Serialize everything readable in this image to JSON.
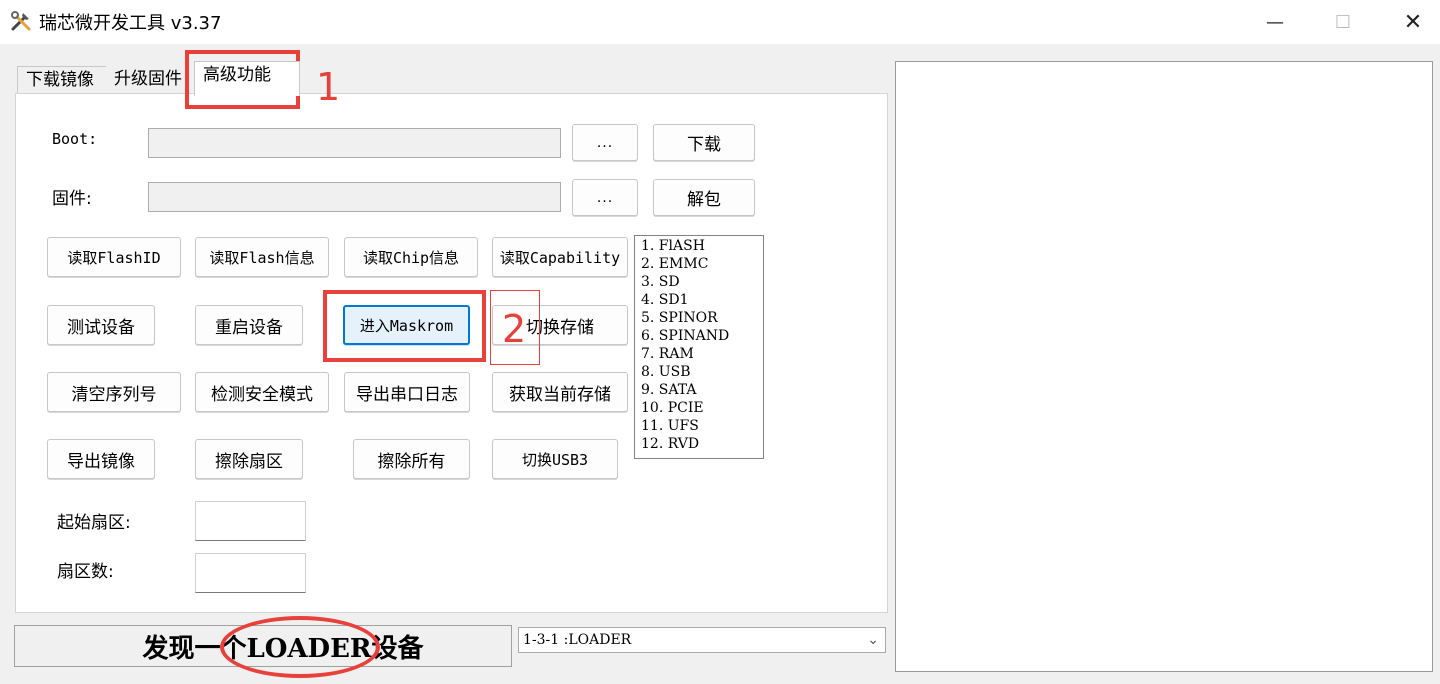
{
  "window": {
    "title": "瑞芯微开发工具 v3.37",
    "minimize_glyph": "—",
    "maximize_glyph": "☐",
    "close_glyph": "✕"
  },
  "tabs": [
    {
      "label": "下载镜像"
    },
    {
      "label": "升级固件"
    },
    {
      "label": "高级功能"
    }
  ],
  "boot": {
    "label": "Boot:",
    "browse_label": "...",
    "action_label": "下载"
  },
  "firmware": {
    "label": "固件:",
    "browse_label": "...",
    "action_label": "解包"
  },
  "buttons": {
    "read_flash_id": "读取FlashID",
    "read_flash_info": "读取Flash信息",
    "read_chip_info": "读取Chip信息",
    "read_capability": "读取Capability",
    "test_device": "测试设备",
    "reboot_device": "重启设备",
    "enter_maskrom": "进入Maskrom",
    "switch_storage": "切换存储",
    "clear_serial": "清空序列号",
    "detect_secure_mode": "检测安全模式",
    "export_serial_log": "导出串口日志",
    "get_current_storage": "获取当前存储",
    "export_image": "导出镜像",
    "erase_sector": "擦除扇区",
    "erase_all": "擦除所有",
    "switch_usb3": "切换USB3"
  },
  "sector": {
    "start_label": "起始扇区:",
    "count_label": "扇区数:",
    "start_value": "",
    "count_value": ""
  },
  "storage_list": [
    "1.  FlASH",
    "2.  EMMC",
    "3.  SD",
    "4.  SD1",
    "5.  SPINOR",
    "6.  SPINAND",
    "7.  RAM",
    "8.  USB",
    "9.  SATA",
    "10.  PCIE",
    "11.  UFS",
    "12.  RVD"
  ],
  "status": {
    "text": "发现一个LOADER设备"
  },
  "device_select": {
    "value": "1-3-1  :LOADER"
  },
  "annotations": {
    "step1": "1",
    "step2": "2",
    "color": "#e8413c"
  }
}
